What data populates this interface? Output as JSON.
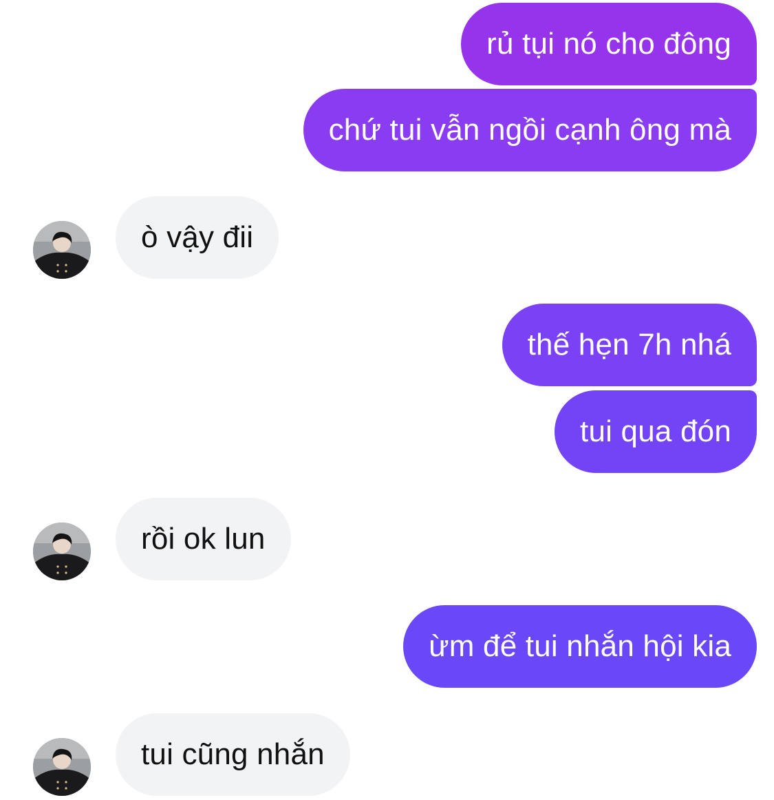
{
  "colors": {
    "outgoing_top": "#9b36ec",
    "outgoing_mid": "#7f41f3",
    "outgoing_bottom": "#6a48f8",
    "incoming_bg": "#f2f3f5",
    "incoming_text": "#111111",
    "outgoing_text": "#ffffff"
  },
  "messages": [
    {
      "side": "outgoing",
      "text": "rủ tụi nó cho đông"
    },
    {
      "side": "outgoing",
      "text": "chứ tui vẫn ngồi cạnh ông mà"
    },
    {
      "side": "incoming",
      "text": "ò vậy đii",
      "avatar": "contact-avatar"
    },
    {
      "side": "outgoing",
      "text": "thế hẹn 7h nhá"
    },
    {
      "side": "outgoing",
      "text": "tui qua đón"
    },
    {
      "side": "incoming",
      "text": "rồi ok lun",
      "avatar": "contact-avatar"
    },
    {
      "side": "outgoing",
      "text": "ừm để tui nhắn hội kia"
    },
    {
      "side": "incoming",
      "text": "tui cũng nhắn",
      "avatar": "contact-avatar"
    }
  ]
}
